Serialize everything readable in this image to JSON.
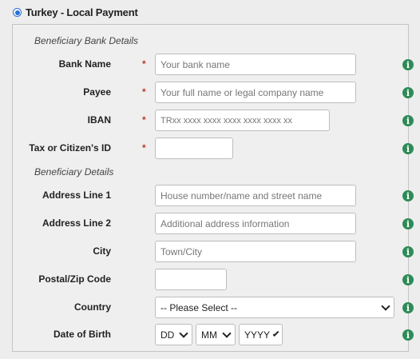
{
  "payment_option": {
    "label": "Turkey - Local Payment",
    "selected": true
  },
  "sections": {
    "bank": "Beneficiary Bank Details",
    "beneficiary": "Beneficiary Details"
  },
  "fields": {
    "bank_name": {
      "label": "Bank Name",
      "placeholder": "Your bank name",
      "required": true
    },
    "payee": {
      "label": "Payee",
      "placeholder": "Your full name or legal company name",
      "required": true
    },
    "iban": {
      "label": "IBAN",
      "placeholder": "TRxx xxxx xxxx xxxx xxxx xxxx xx",
      "required": true
    },
    "tax_id": {
      "label": "Tax or Citizen's ID",
      "placeholder": "",
      "required": true
    },
    "address1": {
      "label": "Address Line 1",
      "placeholder": "House number/name and street name"
    },
    "address2": {
      "label": "Address Line 2",
      "placeholder": "Additional address information"
    },
    "city": {
      "label": "City",
      "placeholder": "Town/City"
    },
    "postal": {
      "label": "Postal/Zip Code",
      "placeholder": ""
    },
    "country": {
      "label": "Country",
      "selected": "-- Please Select --"
    },
    "dob": {
      "label": "Date of Birth",
      "day": "DD",
      "month": "MM",
      "year": "YYYY"
    }
  },
  "required_marker": "*",
  "info_glyph": "i",
  "icons": {
    "info": "info-icon",
    "chevron": "chevron-down-icon"
  },
  "colors": {
    "accent": "#2b6fd6",
    "info": "#2e8b57",
    "required": "#c0392b"
  }
}
